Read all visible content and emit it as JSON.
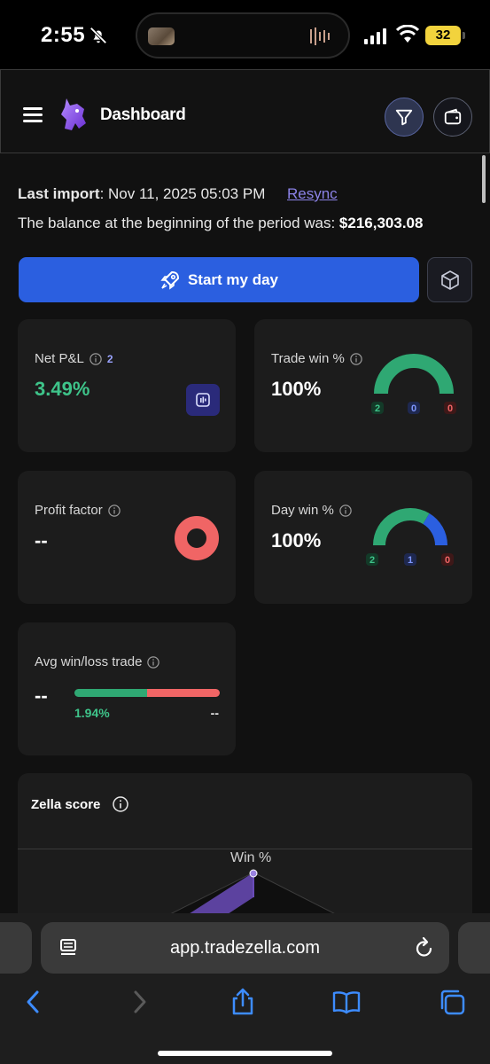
{
  "status_bar": {
    "time": "2:55",
    "battery": "32"
  },
  "header": {
    "title": "Dashboard"
  },
  "import": {
    "label": "Last import",
    "value": ": Nov 11, 2025 05:03 PM",
    "resync": "Resync"
  },
  "balance": {
    "text": "The balance at the beginning of the period was: ",
    "amount": "$216,303.08"
  },
  "start_button": "Start my day",
  "cards": {
    "net_pnl": {
      "label": "Net P&L",
      "badge": "2",
      "value": "3.49%"
    },
    "trade_win": {
      "label": "Trade win %",
      "value": "100%",
      "win": "2",
      "even": "0",
      "loss": "0",
      "win_fraction": 1.0
    },
    "profit_factor": {
      "label": "Profit factor",
      "value": "--"
    },
    "day_win": {
      "label": "Day win %",
      "value": "100%",
      "win": "2",
      "even": "1",
      "loss": "0"
    },
    "avg_win_loss": {
      "label": "Avg win/loss trade",
      "value": "--",
      "win_avg": "1.94%",
      "loss_avg": "--"
    }
  },
  "zella": {
    "title": "Zella score",
    "axis_top": "Win %"
  },
  "safari": {
    "url": "app.tradezella.com"
  },
  "colors": {
    "accent_blue": "#2b5fe0",
    "green": "#2fa873",
    "red": "#f06565",
    "purple_link": "#8b82e6"
  }
}
